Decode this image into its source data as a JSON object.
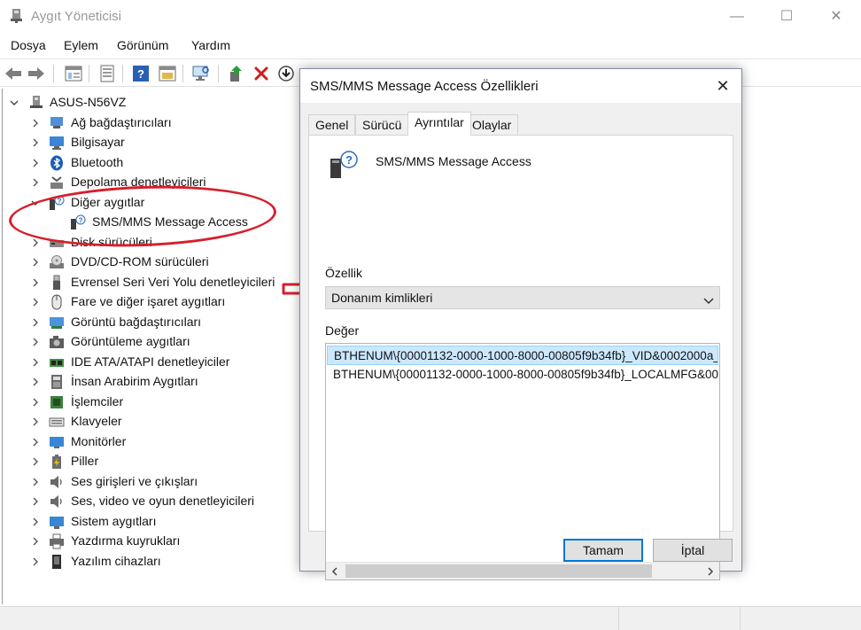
{
  "window": {
    "title": "Aygıt Yöneticisi",
    "controls": {
      "minimize": "—",
      "maximize": "☐",
      "close": "✕"
    }
  },
  "menu": [
    "Dosya",
    "Eylem",
    "Görünüm",
    "Yardım"
  ],
  "tree": {
    "root": "ASUS-N56VZ",
    "items": [
      {
        "label": "Ağ bağdaştırıcıları",
        "icon": "network-adapter-icon"
      },
      {
        "label": "Bilgisayar",
        "icon": "computer-icon"
      },
      {
        "label": "Bluetooth",
        "icon": "bluetooth-icon"
      },
      {
        "label": "Depolama denetleyicileri",
        "icon": "storage-controller-icon"
      },
      {
        "label": "Diğer aygıtlar",
        "icon": "unknown-device-icon",
        "expanded": true
      },
      {
        "label": "SMS/MMS Message Access",
        "icon": "unknown-device-icon",
        "child": true
      },
      {
        "label": "Disk sürücüleri",
        "icon": "disk-drive-icon"
      },
      {
        "label": "DVD/CD-ROM sürücüleri",
        "icon": "dvd-drive-icon"
      },
      {
        "label": "Evrensel Seri Veri Yolu denetleyicileri",
        "icon": "usb-icon"
      },
      {
        "label": "Fare ve diğer işaret aygıtları",
        "icon": "mouse-icon"
      },
      {
        "label": "Görüntü bağdaştırıcıları",
        "icon": "display-adapter-icon"
      },
      {
        "label": "Görüntüleme aygıtları",
        "icon": "camera-icon"
      },
      {
        "label": "IDE ATA/ATAPI denetleyiciler",
        "icon": "ide-controller-icon"
      },
      {
        "label": "İnsan Arabirim Aygıtları",
        "icon": "hid-icon"
      },
      {
        "label": "İşlemciler",
        "icon": "processor-icon"
      },
      {
        "label": "Klavyeler",
        "icon": "keyboard-icon"
      },
      {
        "label": "Monitörler",
        "icon": "monitor-icon"
      },
      {
        "label": "Piller",
        "icon": "battery-icon"
      },
      {
        "label": "Ses girişleri ve çıkışları",
        "icon": "speaker-icon"
      },
      {
        "label": "Ses, video ve oyun denetleyicileri",
        "icon": "audio-controller-icon"
      },
      {
        "label": "Sistem aygıtları",
        "icon": "system-device-icon"
      },
      {
        "label": "Yazdırma kuyrukları",
        "icon": "printer-icon"
      },
      {
        "label": "Yazılım cihazları",
        "icon": "software-device-icon"
      }
    ]
  },
  "dialog": {
    "title": "SMS/MMS Message Access Özellikleri",
    "close": "✕",
    "tabs": [
      "Genel",
      "Sürücü",
      "Ayrıntılar",
      "Olaylar"
    ],
    "active_tab": "Ayrıntılar",
    "device_name": "SMS/MMS Message Access",
    "property_label": "Özellik",
    "property_value": "Donanım kimlikleri",
    "value_label": "Değer",
    "values": [
      "BTHENUM\\{00001132-0000-1000-8000-00805f9b34fb}_VID&0002000a_",
      "BTHENUM\\{00001132-0000-1000-8000-00805f9b34fb}_LOCALMFG&00"
    ],
    "ok_label": "Tamam",
    "cancel_label": "İptal"
  },
  "colors": {
    "annotation": "#d61f2c",
    "selection": "#cce8ff",
    "default_button_border": "#0078d7"
  }
}
